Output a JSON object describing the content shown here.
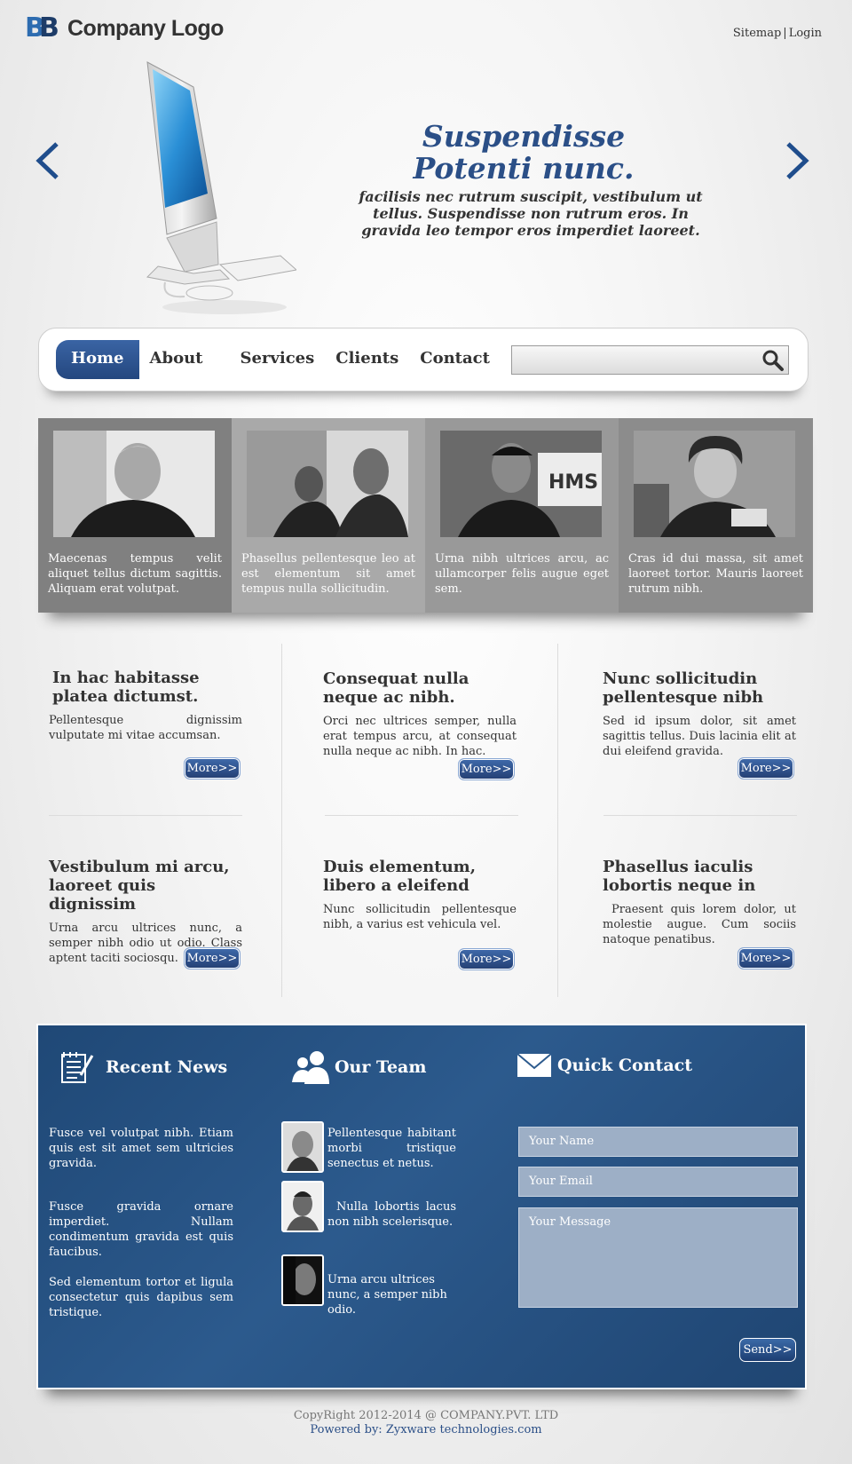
{
  "header": {
    "logo_text": "Company Logo",
    "links": [
      "Sitemap",
      "|",
      "Login"
    ]
  },
  "hero": {
    "title_line1": "Suspendisse",
    "title_line2": "Potenti nunc.",
    "text": "facilisis nec rutrum suscipit, vestibulum ut tellus. Suspendisse non rutrum eros. In gravida leo tempor eros imperdiet laoreet.",
    "prev_arrow": "<",
    "next_arrow": ">"
  },
  "nav": {
    "items": [
      "Home",
      "About",
      "Services",
      "Clients",
      "Contact"
    ],
    "active": "Home",
    "search_placeholder": ""
  },
  "tiles": [
    {
      "caption": "Maecenas tempus velit aliquet tellus dictum sagittis. Aliquam erat volutpat.",
      "bg": "#808080"
    },
    {
      "caption": "Phasellus pellentesque leo at est elementum sit amet tempus nulla sollicitudin.",
      "bg": "#a9a9a9"
    },
    {
      "caption": "Urna nibh ultrices arcu, ac ullamcorper felis augue eget sem.",
      "bg": "#999999"
    },
    {
      "caption": "Cras id dui massa, sit amet laoreet tortor. Mauris laoreet rutrum nibh.",
      "bg": "#8c8c8c"
    }
  ],
  "cards": [
    {
      "title": "In hac habitasse platea dictumst.",
      "text": "Pellentesque dignissim vulputate mi vitae accumsan.",
      "more": "More>>"
    },
    {
      "title": "Consequat nulla neque ac nibh.",
      "text": "Orci nec ultrices semper, nulla erat tempus arcu, at consequat nulla neque ac nibh. In hac.",
      "more": "More>>"
    },
    {
      "title": "Nunc sollicitudin pellentesque nibh",
      "text": "Sed id ipsum dolor, sit amet sagittis tellus. Duis lacinia elit at dui eleifend gravida.",
      "more": "More>>"
    },
    {
      "title": "Vestibulum mi arcu, laoreet quis dignissim",
      "text": "Urna arcu ultrices nunc, a semper nibh odio ut odio. Class aptent taciti sociosqu.",
      "more": "More>>"
    },
    {
      "title": "Duis elementum, libero a eleifend",
      "text": "Nunc sollicitudin pellentesque nibh, a varius est vehicula vel.",
      "more": "More>>"
    },
    {
      "title": "Phasellus iaculis lobortis neque in",
      "text": "Praesent quis lorem dolor, ut molestie augue. Cum sociis natoque penatibus.",
      "more": "More>>"
    }
  ],
  "recent_news": {
    "heading": "Recent News",
    "items": [
      "Fusce vel volutpat nibh. Etiam quis est sit amet sem ultricies gravida.",
      "Fusce gravida ornare imperdiet. Nullam condimentum gravida est quis faucibus.",
      "Sed elementum tortor et ligula consectetur quis dapibus sem tristique."
    ]
  },
  "our_team": {
    "heading": "Our Team",
    "members": [
      "Pellentesque habitant morbi tristique senectus et netus.",
      "Nulla lobortis lacus non nibh scelerisque.",
      "Urna arcu ultrices nunc, a semper nibh odio."
    ]
  },
  "quick_contact": {
    "heading": "Quick Contact",
    "name_placeholder": "Your Name",
    "email_placeholder": "Your Email",
    "message_placeholder": "Your Message",
    "send": "Send>>"
  },
  "footer": {
    "copyright": "CopyRight  2012-2014 @ COMPANY.PVT. LTD",
    "powered_label": "Powered by: ",
    "powered_link": "Zyxware technologies.com"
  },
  "colors": {
    "brand_blue": "#2b4f87",
    "panel_blue": "#2c5a8d"
  }
}
